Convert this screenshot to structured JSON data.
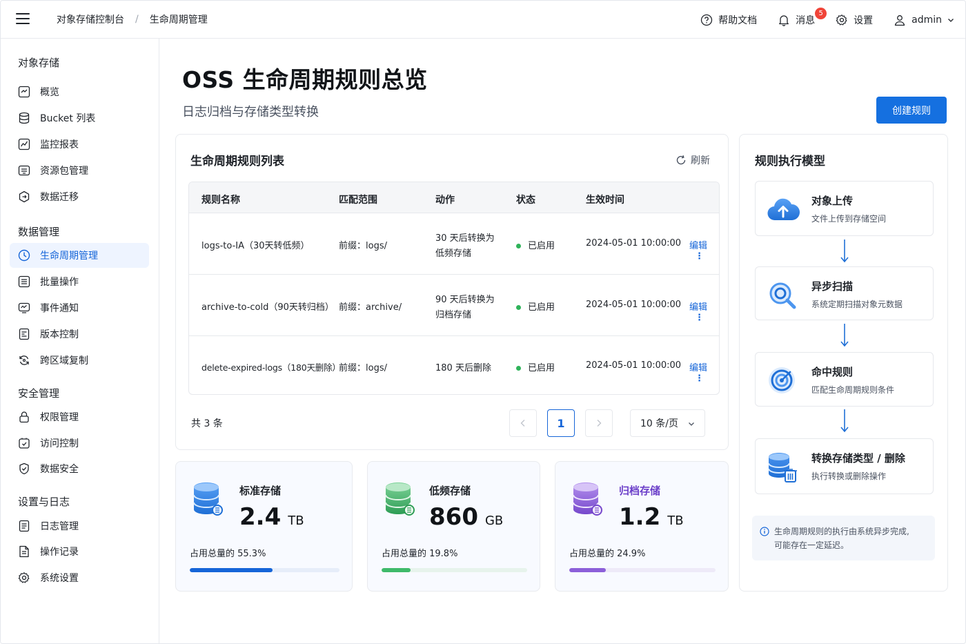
{
  "topbar": {
    "breadcrumb": [
      "对象存储控制台",
      "生命周期管理"
    ],
    "breadcrumb_sep": "/",
    "help": "帮助文档",
    "messages": "消息",
    "message_count": "5",
    "settings": "设置",
    "user": "admin"
  },
  "sidebar": {
    "groups": [
      {
        "title": "对象存储",
        "items": [
          "概览",
          "Bucket 列表",
          "监控报表",
          "资源包管理",
          "数据迁移"
        ]
      },
      {
        "title": "数据管理",
        "items": [
          "生命周期管理",
          "批量操作",
          "事件通知",
          "版本控制",
          "跨区域复制"
        ]
      },
      {
        "title": "安全管理",
        "items": [
          "权限管理",
          "访问控制",
          "数据安全"
        ]
      },
      {
        "title": "设置与日志",
        "items": [
          "日志管理",
          "操作记录",
          "系统设置"
        ]
      }
    ],
    "active_item": "生命周期管理"
  },
  "main": {
    "title": "OSS 生命周期规则总览",
    "subtitle": "日志归档与存储类型转换",
    "create_button": "创建规则"
  },
  "rules_card": {
    "title": "生命周期规则列表",
    "refresh": "刷新",
    "columns": [
      "规则名称",
      "匹配范围",
      "动作",
      "状态",
      "生效时间"
    ],
    "rows": [
      {
        "name": "logs-to-IA（30天转低频）",
        "scope": "前缀：logs/",
        "action_1": "30 天后转换为",
        "action_2": "低频存储",
        "status": "已启用",
        "time": "2024-05-01 10:00:00",
        "edit": "编辑",
        "more": "⋮"
      },
      {
        "name": "archive-to-cold（90天转归档）",
        "scope": "前缀：archive/",
        "action_1": "90 天后转换为",
        "action_2": "归档存储",
        "status": "已启用",
        "time": "2024-05-01 10:00:00",
        "edit": "编辑",
        "more": "⋮"
      },
      {
        "name": "delete-expired-logs（180天删除）",
        "scope": "前缀：logs/",
        "action_1": "180 天后删除",
        "action_2": "",
        "status": "已启用",
        "time": "2024-05-01 10:00:00",
        "edit": "编辑",
        "more": "⋮"
      }
    ],
    "total": "共 3 条",
    "current_page": "1",
    "page_size": "10 条/页"
  },
  "stats": [
    {
      "label": "标准存储",
      "value": "2.4",
      "unit": "TB",
      "pct_text": "占用总量的 55.3%",
      "pct": 55.3,
      "color": "#1565d8",
      "label_color": "#1f2329",
      "track": "#e6edf9"
    },
    {
      "label": "低频存储",
      "value": "860",
      "unit": "GB",
      "pct_text": "占用总量的 19.8%",
      "pct": 19.8,
      "color": "#3fba6a",
      "label_color": "#1f2329",
      "track": "#e7f3ec"
    },
    {
      "label": "归档存储",
      "value": "1.2",
      "unit": "TB",
      "pct_text": "占用总量的 24.9%",
      "pct": 24.9,
      "color": "#8c5fd9",
      "label_color": "#6b3fc9",
      "track": "#eeeaf8"
    }
  ],
  "model_card": {
    "title": "规则执行模型",
    "steps": [
      {
        "title": "对象上传",
        "desc": "文件上传到存储空间"
      },
      {
        "title": "异步扫描",
        "desc": "系统定期扫描对象元数据"
      },
      {
        "title": "命中规则",
        "desc": "匹配生命周期规则条件"
      },
      {
        "title": "转换存储类型 / 删除",
        "desc": "执行转换或删除操作"
      }
    ],
    "note_1": "生命周期规则的执行由系统异步完成,",
    "note_2": "可能存在一定延迟。"
  }
}
